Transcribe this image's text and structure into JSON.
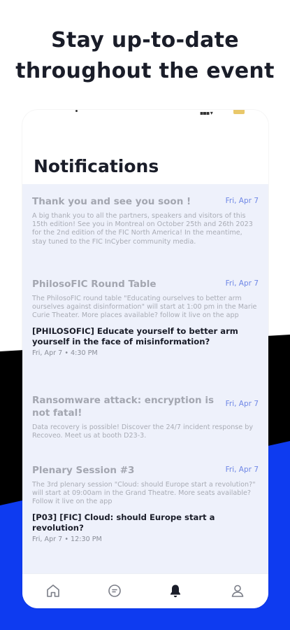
{
  "headline": {
    "line1": "Stay up-to-date",
    "line2": "throughout the event"
  },
  "colors": {
    "accent_blue": "#0e3bf0",
    "date_blue": "#6f87e6",
    "list_bg": "#eef1fb",
    "dark_text": "#1a1d29"
  },
  "screen": {
    "title": "Notifications",
    "notifications": [
      {
        "title": "Thank you and see you soon !",
        "date": "Fri, Apr 7",
        "body": "A big thank you to all the partners, speakers and visitors of this 15th edition! See you in Montreal on October 25th and 26th 2023 for the 2nd edition of the FIC North America! In the meantime, stay tuned to the FIC InCyber community media."
      },
      {
        "title": "PhilosoFIC  Round Table",
        "date": "Fri, Apr 7",
        "body": "The PhilosoFIC round table \"Educating ourselves to better arm ourselves against disinformation\" will start at 1:00 pm in the Marie Curie Theater. More places available? follow it live on the app",
        "session_title": "[PHILOSOFIC] Educate yourself to better arm yourself in the face of misinformation?",
        "session_meta": "Fri, Apr 7 • 4:30 PM"
      },
      {
        "title": "Ransomware attack: encryption is not fatal!",
        "date": "Fri, Apr 7",
        "body": "Data recovery is possible! Discover the 24/7 incident response by Recoveo. Meet us at booth D23-3."
      },
      {
        "title": "Plenary Session #3",
        "date": "Fri, Apr 7",
        "body": "The 3rd plenary session \"Cloud: should Europe start a revolution?\" will start at 09:00am in the Grand Theatre. More seats available? Follow it live on the app",
        "session_title": "[P03] [FIC] Cloud: should Europe start a revolution?",
        "session_meta": "Fri, Apr 7 • 12:30 PM"
      }
    ],
    "tabs": [
      {
        "icon": "home-icon",
        "active": false
      },
      {
        "icon": "chat-icon",
        "active": false
      },
      {
        "icon": "bell-icon",
        "active": true
      },
      {
        "icon": "profile-icon",
        "active": false
      }
    ]
  }
}
